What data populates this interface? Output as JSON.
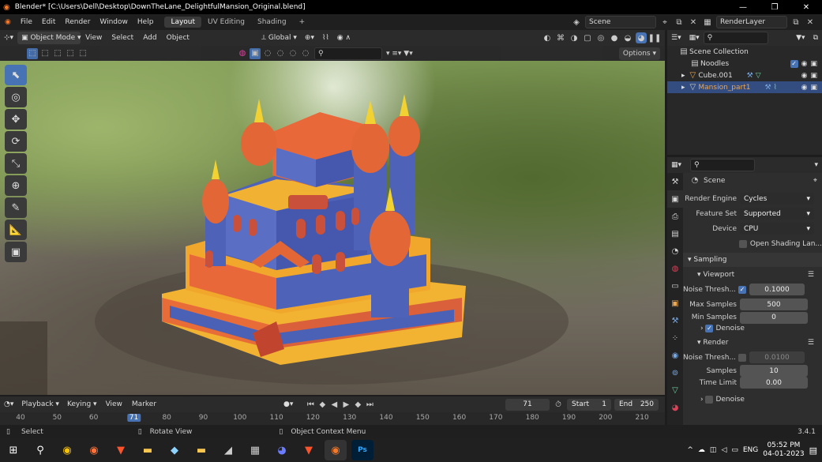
{
  "window": {
    "title": "Blender* [C:\\Users\\Dell\\Desktop\\DownTheLane_DelightfulMansion_Original.blend]"
  },
  "menu": [
    "File",
    "Edit",
    "Render",
    "Window",
    "Help"
  ],
  "workspaces": [
    {
      "label": "Layout"
    },
    {
      "label": "UV Editing"
    },
    {
      "label": "Shading"
    }
  ],
  "scene": {
    "name": "Scene",
    "render_layer": "RenderLayer"
  },
  "viewport": {
    "mode": "Object Mode",
    "menus": [
      "View",
      "Select",
      "Add",
      "Object"
    ],
    "orientation": "Global",
    "options_label": "Options"
  },
  "outliner": {
    "root": "Scene Collection",
    "items": [
      {
        "label": "Noodles"
      },
      {
        "label": "Cube.001"
      },
      {
        "label": "Mansion_part1"
      }
    ]
  },
  "properties": {
    "context": "Scene",
    "render_engine_label": "Render Engine",
    "render_engine": "Cycles",
    "feature_set_label": "Feature Set",
    "feature_set": "Supported",
    "device_label": "Device",
    "device": "CPU",
    "osl_label": "Open Shading Lan...",
    "sampling": "Sampling",
    "viewport_sub": "Viewport",
    "noise_threshold_label": "Noise Thresh...",
    "vp_noise": "0.1000",
    "max_samples_label": "Max Samples",
    "vp_max_samples": "500",
    "min_samples_label": "Min Samples",
    "vp_min_samples": "0",
    "denoise_label": "Denoise",
    "render_sub": "Render",
    "r_noise": "0.0100",
    "samples_label": "Samples",
    "r_samples": "10",
    "time_limit_label": "Time Limit",
    "r_time_limit": "0.00"
  },
  "timeline": {
    "menus": [
      "Playback",
      "Keying",
      "View",
      "Marker"
    ],
    "current_frame": "71",
    "start_label": "Start",
    "start": "1",
    "end_label": "End",
    "end": "250",
    "ticks": [
      "40",
      "50",
      "60",
      "71",
      "80",
      "90",
      "100",
      "110",
      "120",
      "130",
      "140",
      "150",
      "160",
      "170",
      "180",
      "190",
      "200",
      "210"
    ]
  },
  "status": {
    "select": "Select",
    "rotate": "Rotate View",
    "context": "Object Context Menu",
    "version": "3.4.1"
  },
  "taskbar": {
    "time": "05:52 PM",
    "date": "04-01-2023",
    "lang": "ENG"
  },
  "colors": {
    "accent": "#4772b3",
    "active_object": "#e8a657"
  }
}
